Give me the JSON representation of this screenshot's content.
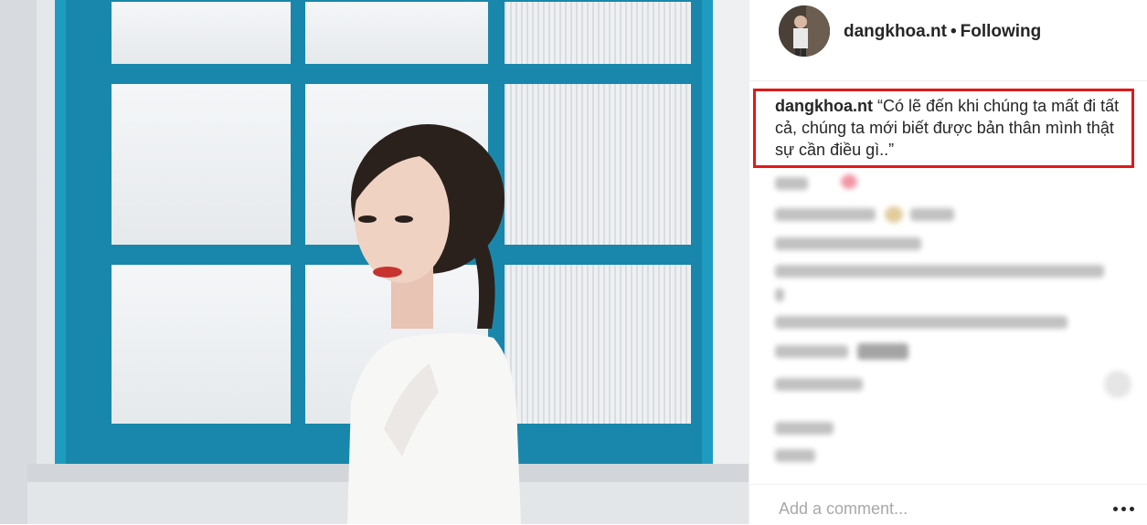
{
  "post": {
    "photo_alt": "Woman in white standing in front of blue window"
  },
  "header": {
    "username": "dangkhoa.nt",
    "separator": "•",
    "follow_status": "Following"
  },
  "caption": {
    "username": "dangkhoa.nt",
    "text": "“Có lẽ đến khi chúng ta mất đi tất cả, chúng ta mới biết được bản thân mình thật sự cần điều gì..”"
  },
  "comment_box": {
    "placeholder": "Add a comment..."
  },
  "colors": {
    "highlight_border": "#e01a1a",
    "window_frame": "#1e9bc1",
    "text": "#262626",
    "placeholder": "#a8a8a8"
  },
  "icons": {
    "more": "more-options-icon",
    "heart": "heart-icon"
  }
}
